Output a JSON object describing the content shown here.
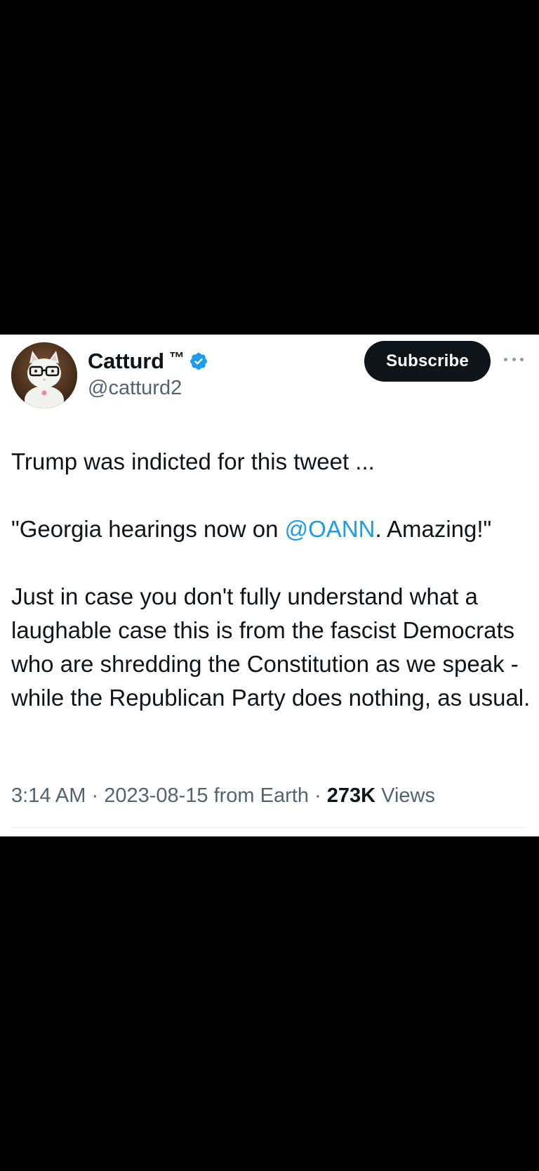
{
  "tweet": {
    "author": {
      "display_name": "Catturd",
      "trademark": "™",
      "handle": "@catturd2",
      "verified": true
    },
    "subscribe_label": "Subscribe",
    "text": {
      "line1": "Trump was indicted for this tweet ...",
      "quote_prefix": "\"Georgia hearings now on ",
      "quote_mention": "@OANN",
      "quote_suffix": ". Amazing!\"",
      "paragraph3": "Just in case you don't fully understand what a laughable case this is from the fascist Democrats who are shredding the Constitution as we speak - while the Republican Party does nothing, as usual."
    },
    "meta": {
      "time": "3:14 AM",
      "separator": " · ",
      "date_source": "2023-08-15 from Earth",
      "views_count": "273K",
      "views_label": " Views"
    }
  },
  "colors": {
    "text_primary": "#0f1419",
    "text_secondary": "#536471",
    "link": "#1d9bf0",
    "verified": "#1d9bf0",
    "button_bg": "#0f1419"
  },
  "icons": {
    "verified": "verified-badge-icon",
    "more": "more-options-icon"
  }
}
